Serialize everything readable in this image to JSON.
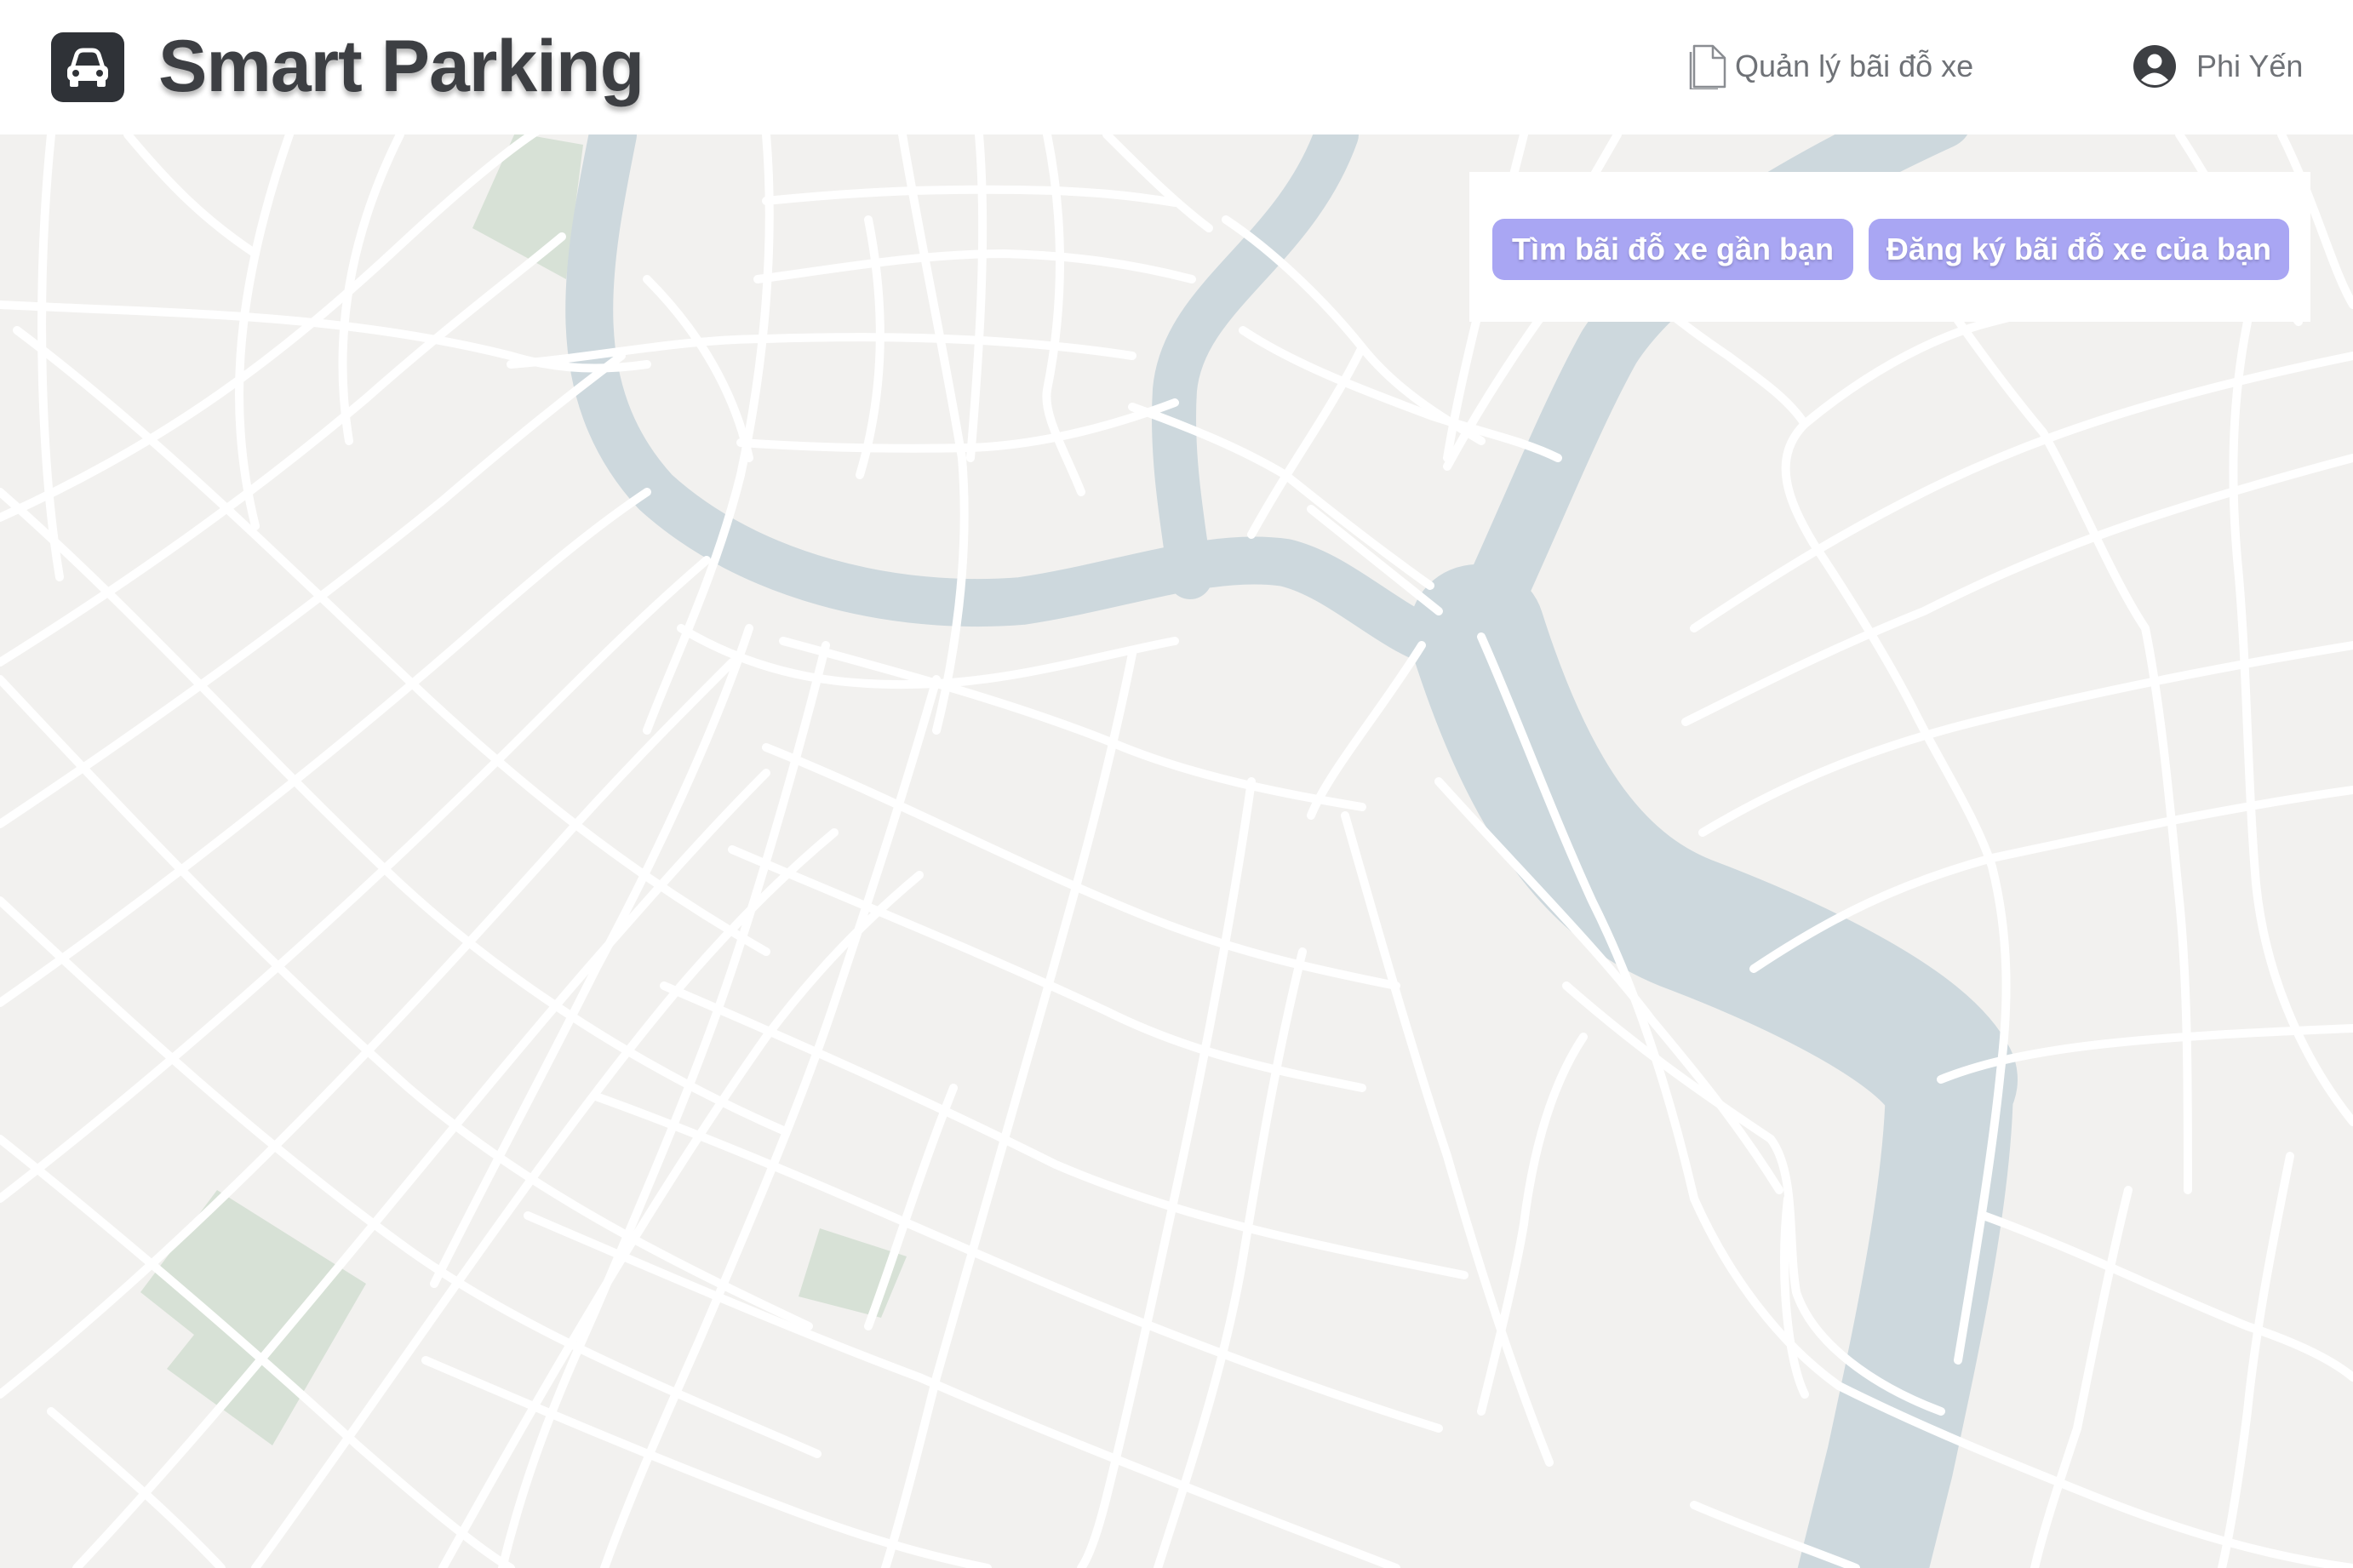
{
  "header": {
    "logo_icon": "car-icon",
    "title": "Smart Parking",
    "nav_link": {
      "icon": "document-icon",
      "label": "Quản lý bãi đỗ xe"
    },
    "user": {
      "icon": "user-circle-icon",
      "name": "Phi Yến"
    }
  },
  "actions": {
    "find_nearby": "Tìm bãi đỗ xe gần bạn",
    "register_lot": "Đăng ký bãi đỗ xe của bạn"
  },
  "colors": {
    "map_land": "#f2f1ef",
    "map_road": "#ffffff",
    "map_water": "#cdd8dd",
    "map_park": "#d7e1d6",
    "accent_button": "#a9a6f3",
    "logo_bg": "#2f3237",
    "title_text": "#3d3f43",
    "nav_text": "#6f7277"
  }
}
